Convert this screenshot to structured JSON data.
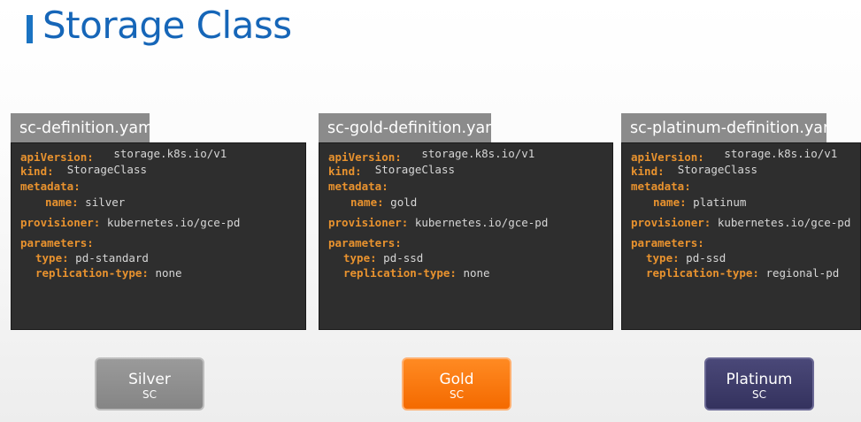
{
  "slide": {
    "title": "Storage Class",
    "accent_color": "#1666b8"
  },
  "panels": [
    {
      "filename": "sc-definition.yaml",
      "lines": [
        {
          "key": "apiVersion:",
          "value": "storage.k8s.io/v1"
        },
        {
          "key": "kind:",
          "value": "StorageClass"
        },
        {
          "key": "metadata:",
          "value": ""
        },
        {
          "key": "name:",
          "value": "silver"
        },
        {
          "key": "provisioner:",
          "value": "kubernetes.io/gce-pd"
        },
        {
          "key": "parameters:",
          "value": ""
        },
        {
          "key": "type:",
          "value": "pd-standard"
        },
        {
          "key": "replication-type:",
          "value": "none"
        }
      ]
    },
    {
      "filename": "sc-gold-definition.yaml",
      "lines": [
        {
          "key": "apiVersion:",
          "value": "storage.k8s.io/v1"
        },
        {
          "key": "kind:",
          "value": "StorageClass"
        },
        {
          "key": "metadata:",
          "value": ""
        },
        {
          "key": "name:",
          "value": "gold"
        },
        {
          "key": "provisioner:",
          "value": "kubernetes.io/gce-pd"
        },
        {
          "key": "parameters:",
          "value": ""
        },
        {
          "key": "type:",
          "value": "pd-ssd"
        },
        {
          "key": "replication-type:",
          "value": "none"
        }
      ]
    },
    {
      "filename": "sc-platinum-definition.yaml",
      "lines": [
        {
          "key": "apiVersion:",
          "value": "storage.k8s.io/v1"
        },
        {
          "key": "kind:",
          "value": "StorageClass"
        },
        {
          "key": "metadata:",
          "value": ""
        },
        {
          "key": "name:",
          "value": "platinum"
        },
        {
          "key": "provisioner:",
          "value": "kubernetes.io/gce-pd"
        },
        {
          "key": "parameters:",
          "value": ""
        },
        {
          "key": "type:",
          "value": "pd-ssd"
        },
        {
          "key": "replication-type:",
          "value": "regional-pd"
        }
      ]
    }
  ],
  "storage_classes": [
    {
      "name": "Silver",
      "sub": "SC",
      "color": "#8f8f8f"
    },
    {
      "name": "Gold",
      "sub": "SC",
      "color": "#f97a10"
    },
    {
      "name": "Platinum",
      "sub": "SC",
      "color": "#3d3b68"
    }
  ]
}
